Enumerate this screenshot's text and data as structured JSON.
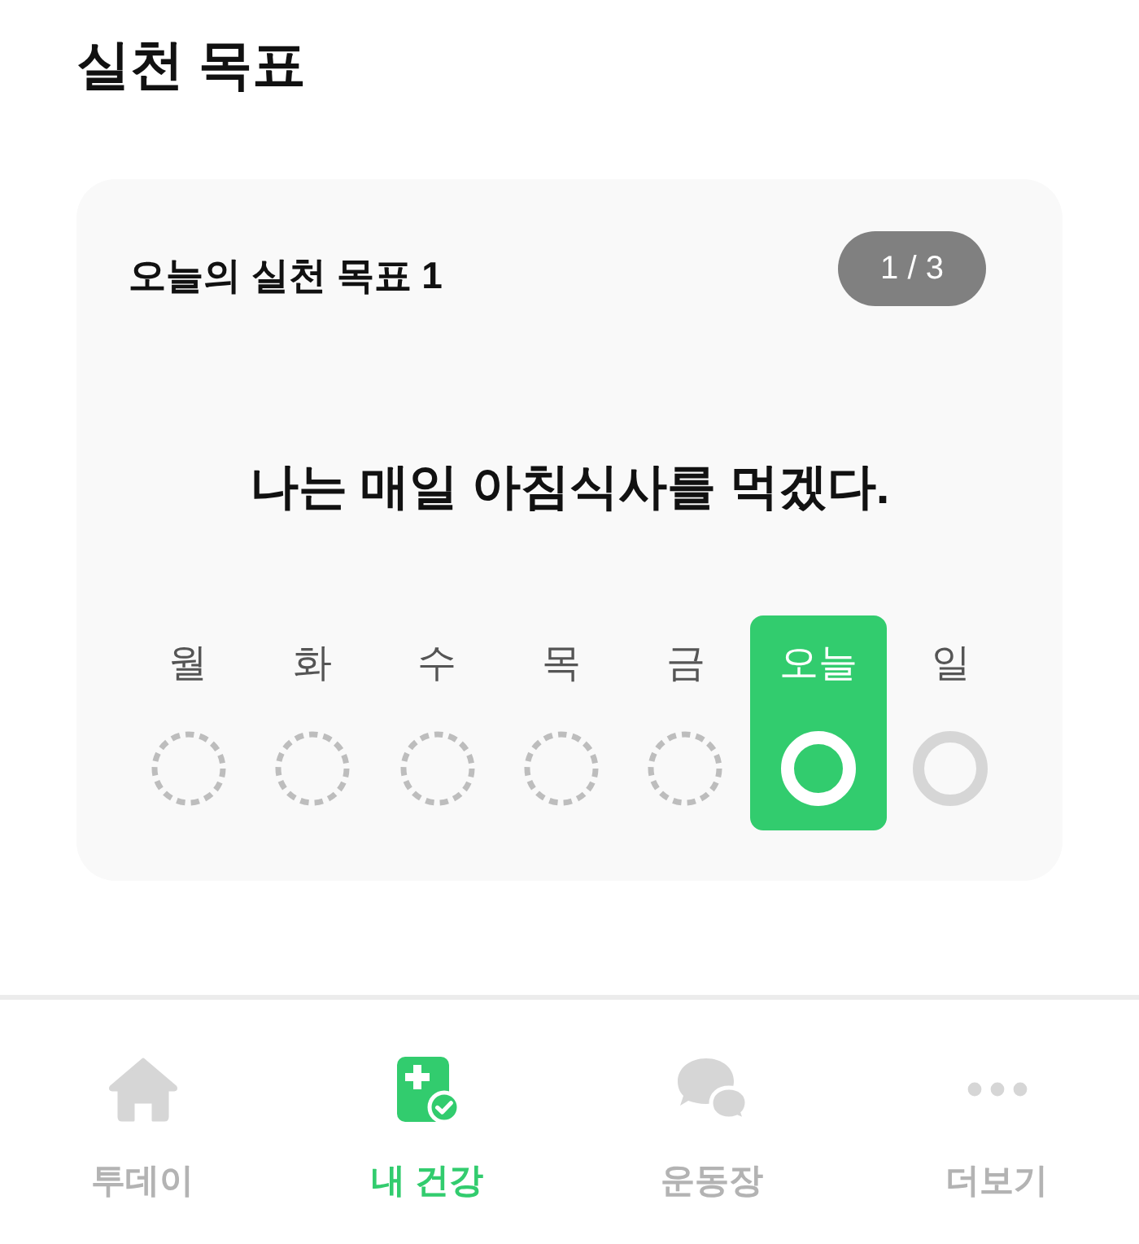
{
  "header": {
    "title": "실천 목표"
  },
  "goal_card": {
    "label": "오늘의 실천 목표 1",
    "page_indicator": "1 / 3",
    "goal": "나는 매일 아침식사를 먹겠다.",
    "days": [
      {
        "label": "월",
        "kind": "past",
        "selected": false
      },
      {
        "label": "화",
        "kind": "past",
        "selected": false
      },
      {
        "label": "수",
        "kind": "past",
        "selected": false
      },
      {
        "label": "목",
        "kind": "past",
        "selected": false
      },
      {
        "label": "금",
        "kind": "past",
        "selected": false
      },
      {
        "label": "오늘",
        "kind": "today",
        "selected": true
      },
      {
        "label": "일",
        "kind": "future",
        "selected": false
      }
    ]
  },
  "tab_bar": [
    {
      "label": "투데이",
      "selected": false
    },
    {
      "label": "내 건강",
      "selected": true
    },
    {
      "label": "운동장",
      "selected": false
    },
    {
      "label": "더보기",
      "selected": false
    }
  ]
}
